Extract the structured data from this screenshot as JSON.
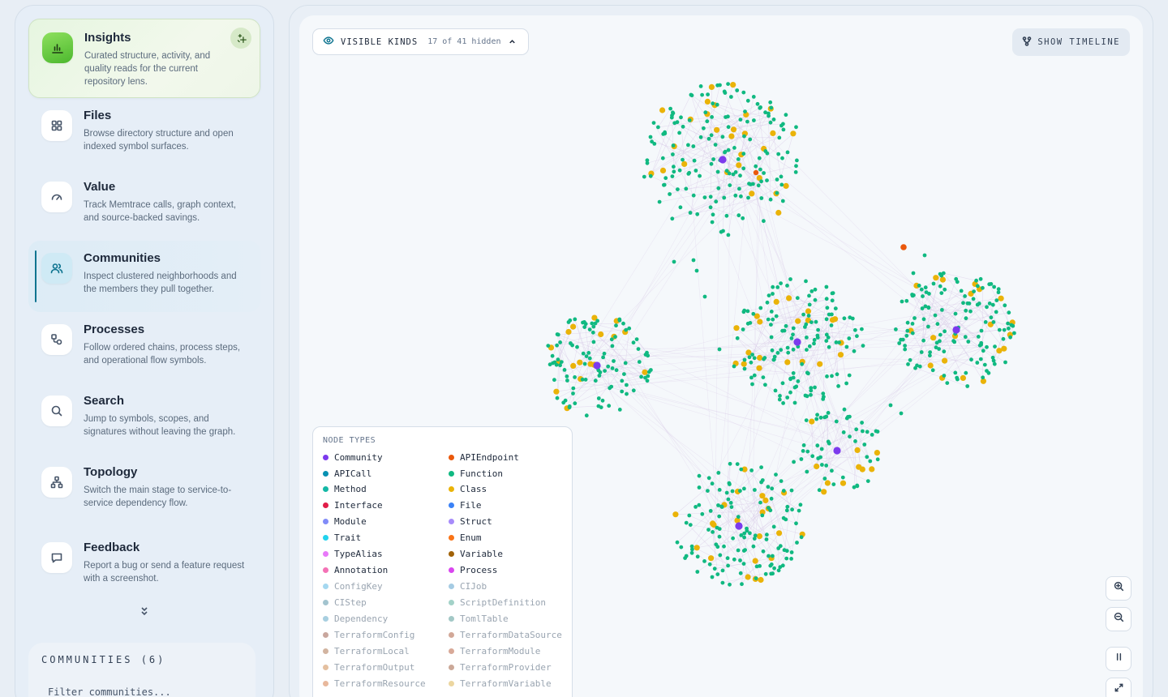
{
  "sidebar": {
    "items": [
      {
        "title": "Insights",
        "desc": "Curated structure, activity, and quality reads for the current repository lens.",
        "icon": "bar-chart-icon"
      },
      {
        "title": "Files",
        "desc": "Browse directory structure and open indexed symbol surfaces.",
        "icon": "grid-icon"
      },
      {
        "title": "Value",
        "desc": "Track Memtrace calls, graph context, and source-backed savings.",
        "icon": "gauge-icon"
      },
      {
        "title": "Communities",
        "desc": "Inspect clustered neighborhoods and the members they pull together.",
        "icon": "users-icon"
      },
      {
        "title": "Processes",
        "desc": "Follow ordered chains, process steps, and operational flow symbols.",
        "icon": "flow-icon"
      },
      {
        "title": "Search",
        "desc": "Jump to symbols, scopes, and signatures without leaving the graph.",
        "icon": "search-icon"
      },
      {
        "title": "Topology",
        "desc": "Switch the main stage to service-to-service dependency flow.",
        "icon": "topology-icon"
      },
      {
        "title": "Feedback",
        "desc": "Report a bug or send a feature request with a screenshot.",
        "icon": "message-icon"
      }
    ],
    "communities": {
      "title": "COMMUNITIES (6)",
      "filter_placeholder": "Filter communities..."
    }
  },
  "toolbar": {
    "visible_kinds_label": "VISIBLE KINDS",
    "hidden_count": "17 of 41 hidden",
    "timeline_label": "SHOW TIMELINE"
  },
  "legend": {
    "title": "NODE TYPES",
    "items": [
      {
        "label": "Community",
        "color": "#7c3aed",
        "dim": false
      },
      {
        "label": "APIEndpoint",
        "color": "#ea580c",
        "dim": false
      },
      {
        "label": "APICall",
        "color": "#0891b2",
        "dim": false
      },
      {
        "label": "Function",
        "color": "#10b981",
        "dim": false
      },
      {
        "label": "Method",
        "color": "#14b8a6",
        "dim": false
      },
      {
        "label": "Class",
        "color": "#eab308",
        "dim": false
      },
      {
        "label": "Interface",
        "color": "#e11d48",
        "dim": false
      },
      {
        "label": "File",
        "color": "#3b82f6",
        "dim": false
      },
      {
        "label": "Module",
        "color": "#818cf8",
        "dim": false
      },
      {
        "label": "Struct",
        "color": "#a78bfa",
        "dim": false
      },
      {
        "label": "Trait",
        "color": "#22d3ee",
        "dim": false
      },
      {
        "label": "Enum",
        "color": "#f97316",
        "dim": false
      },
      {
        "label": "TypeAlias",
        "color": "#e879f9",
        "dim": false
      },
      {
        "label": "Variable",
        "color": "#a16207",
        "dim": false
      },
      {
        "label": "Annotation",
        "color": "#f472b6",
        "dim": false
      },
      {
        "label": "Process",
        "color": "#d946ef",
        "dim": false
      },
      {
        "label": "ConfigKey",
        "color": "#a5d8f0",
        "dim": true
      },
      {
        "label": "CIJob",
        "color": "#a5cbe3",
        "dim": true
      },
      {
        "label": "CIStep",
        "color": "#a3c4cf",
        "dim": true
      },
      {
        "label": "ScriptDefinition",
        "color": "#a3d2c8",
        "dim": true
      },
      {
        "label": "Dependency",
        "color": "#a8cfe0",
        "dim": true
      },
      {
        "label": "TomlTable",
        "color": "#a3c8c6",
        "dim": true
      },
      {
        "label": "TerraformConfig",
        "color": "#c9a79e",
        "dim": true
      },
      {
        "label": "TerraformDataSource",
        "color": "#d2a898",
        "dim": true
      },
      {
        "label": "TerraformLocal",
        "color": "#d2b4a0",
        "dim": true
      },
      {
        "label": "TerraformModule",
        "color": "#d8a998",
        "dim": true
      },
      {
        "label": "TerraformOutput",
        "color": "#e4c0a0",
        "dim": true
      },
      {
        "label": "TerraformProvider",
        "color": "#cba898",
        "dim": true
      },
      {
        "label": "TerraformResource",
        "color": "#e8b89c",
        "dim": true
      },
      {
        "label": "TerraformVariable",
        "color": "#ecd6a0",
        "dim": true
      }
    ]
  },
  "graph": {
    "colors": {
      "function": "#10b981",
      "class": "#eab308",
      "community": "#7c3aed",
      "endpoint": "#ea580c",
      "edge": "#d7c8e6"
    }
  }
}
